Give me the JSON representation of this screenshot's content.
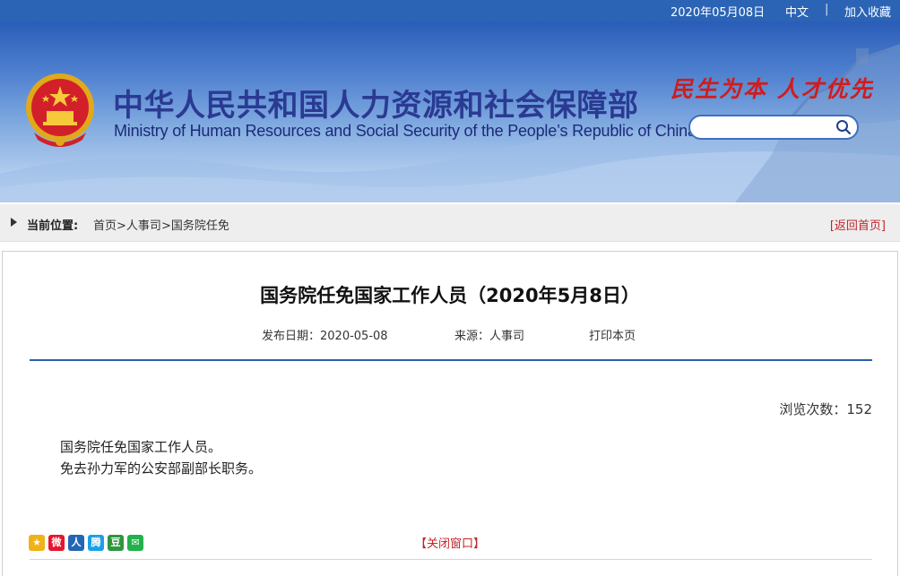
{
  "topbar": {
    "date": "2020年05月08日",
    "lang": "中文",
    "separator": "|",
    "favorite": "加入收藏"
  },
  "header": {
    "title_cn": "中华人民共和国人力资源和社会保障部",
    "title_en": "Ministry of Human Resources and Social Security of the People’s Republic of China",
    "slogan": "民生为本 人才优先",
    "search_value": ""
  },
  "breadcrumb": {
    "label": "当前位置:",
    "items": [
      "首页",
      "人事司",
      "国务院任免"
    ],
    "divider": ">",
    "back": "[返回首页]"
  },
  "article": {
    "title": "国务院任免国家工作人员（2020年5月8日）",
    "publish_date": "发布日期：2020-05-08",
    "source": "来源：人事司",
    "print": "打印本页",
    "views": "浏览次数：152",
    "paragraphs": [
      "国务院任免国家工作人员。",
      "免去孙力军的公安部副部长职务。"
    ]
  },
  "footer": {
    "close": "【关闭窗口】",
    "share_icons": [
      {
        "name": "qzone-share-icon",
        "color": "#f0b21a",
        "glyph": "★"
      },
      {
        "name": "weibo-share-icon",
        "color": "#e6162d",
        "glyph": "微"
      },
      {
        "name": "renren-share-icon",
        "color": "#2266b6",
        "glyph": "人"
      },
      {
        "name": "tencent-share-icon",
        "color": "#1aa0e6",
        "glyph": "腾"
      },
      {
        "name": "douban-share-icon",
        "color": "#2e963d",
        "glyph": "豆"
      },
      {
        "name": "wechat-share-icon",
        "color": "#22b14c",
        "glyph": "✉"
      }
    ]
  },
  "colors": {
    "topbar": "#2c64b5",
    "title_blue": "#2a3a92",
    "slogan_red": "#d01c1c",
    "rule_blue": "#2b5fae",
    "link_red": "#c0252a"
  }
}
